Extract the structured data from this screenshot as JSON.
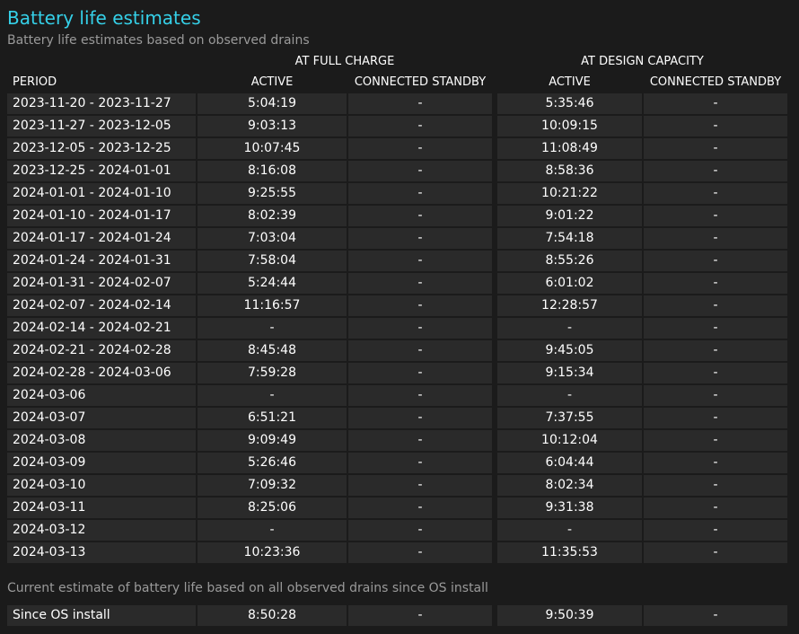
{
  "title": "Battery life estimates",
  "subtitle": "Battery life estimates based on observed drains",
  "groups": {
    "full_charge": "AT FULL CHARGE",
    "design_capacity": "AT DESIGN CAPACITY"
  },
  "headers": {
    "period": "PERIOD",
    "fc_active": "ACTIVE",
    "fc_standby": "CONNECTED STANDBY",
    "dc_active": "ACTIVE",
    "dc_standby": "CONNECTED STANDBY"
  },
  "rows": [
    {
      "period": "2023-11-20 - 2023-11-27",
      "fc_active": "5:04:19",
      "fc_standby": "-",
      "dc_active": "5:35:46",
      "dc_standby": "-"
    },
    {
      "period": "2023-11-27 - 2023-12-05",
      "fc_active": "9:03:13",
      "fc_standby": "-",
      "dc_active": "10:09:15",
      "dc_standby": "-"
    },
    {
      "period": "2023-12-05 - 2023-12-25",
      "fc_active": "10:07:45",
      "fc_standby": "-",
      "dc_active": "11:08:49",
      "dc_standby": "-"
    },
    {
      "period": "2023-12-25 - 2024-01-01",
      "fc_active": "8:16:08",
      "fc_standby": "-",
      "dc_active": "8:58:36",
      "dc_standby": "-"
    },
    {
      "period": "2024-01-01 - 2024-01-10",
      "fc_active": "9:25:55",
      "fc_standby": "-",
      "dc_active": "10:21:22",
      "dc_standby": "-"
    },
    {
      "period": "2024-01-10 - 2024-01-17",
      "fc_active": "8:02:39",
      "fc_standby": "-",
      "dc_active": "9:01:22",
      "dc_standby": "-"
    },
    {
      "period": "2024-01-17 - 2024-01-24",
      "fc_active": "7:03:04",
      "fc_standby": "-",
      "dc_active": "7:54:18",
      "dc_standby": "-"
    },
    {
      "period": "2024-01-24 - 2024-01-31",
      "fc_active": "7:58:04",
      "fc_standby": "-",
      "dc_active": "8:55:26",
      "dc_standby": "-"
    },
    {
      "period": "2024-01-31 - 2024-02-07",
      "fc_active": "5:24:44",
      "fc_standby": "-",
      "dc_active": "6:01:02",
      "dc_standby": "-"
    },
    {
      "period": "2024-02-07 - 2024-02-14",
      "fc_active": "11:16:57",
      "fc_standby": "-",
      "dc_active": "12:28:57",
      "dc_standby": "-"
    },
    {
      "period": "2024-02-14 - 2024-02-21",
      "fc_active": "-",
      "fc_standby": "-",
      "dc_active": "-",
      "dc_standby": "-"
    },
    {
      "period": "2024-02-21 - 2024-02-28",
      "fc_active": "8:45:48",
      "fc_standby": "-",
      "dc_active": "9:45:05",
      "dc_standby": "-"
    },
    {
      "period": "2024-02-28 - 2024-03-06",
      "fc_active": "7:59:28",
      "fc_standby": "-",
      "dc_active": "9:15:34",
      "dc_standby": "-"
    },
    {
      "period": "2024-03-06",
      "fc_active": "-",
      "fc_standby": "-",
      "dc_active": "-",
      "dc_standby": "-"
    },
    {
      "period": "2024-03-07",
      "fc_active": "6:51:21",
      "fc_standby": "-",
      "dc_active": "7:37:55",
      "dc_standby": "-"
    },
    {
      "period": "2024-03-08",
      "fc_active": "9:09:49",
      "fc_standby": "-",
      "dc_active": "10:12:04",
      "dc_standby": "-"
    },
    {
      "period": "2024-03-09",
      "fc_active": "5:26:46",
      "fc_standby": "-",
      "dc_active": "6:04:44",
      "dc_standby": "-"
    },
    {
      "period": "2024-03-10",
      "fc_active": "7:09:32",
      "fc_standby": "-",
      "dc_active": "8:02:34",
      "dc_standby": "-"
    },
    {
      "period": "2024-03-11",
      "fc_active": "8:25:06",
      "fc_standby": "-",
      "dc_active": "9:31:38",
      "dc_standby": "-"
    },
    {
      "period": "2024-03-12",
      "fc_active": "-",
      "fc_standby": "-",
      "dc_active": "-",
      "dc_standby": "-"
    },
    {
      "period": "2024-03-13",
      "fc_active": "10:23:36",
      "fc_standby": "-",
      "dc_active": "11:35:53",
      "dc_standby": "-"
    }
  ],
  "since_install": {
    "note": "Current estimate of battery life based on all observed drains since OS install",
    "period": "Since OS install",
    "fc_active": "8:50:28",
    "fc_standby": "-",
    "dc_active": "9:50:39",
    "dc_standby": "-"
  },
  "colors": {
    "background": "#1b1b1b",
    "cell": "#2a2a2a",
    "title": "#35d0e8",
    "muted": "#9a9a9a",
    "text": "#ffffff"
  }
}
